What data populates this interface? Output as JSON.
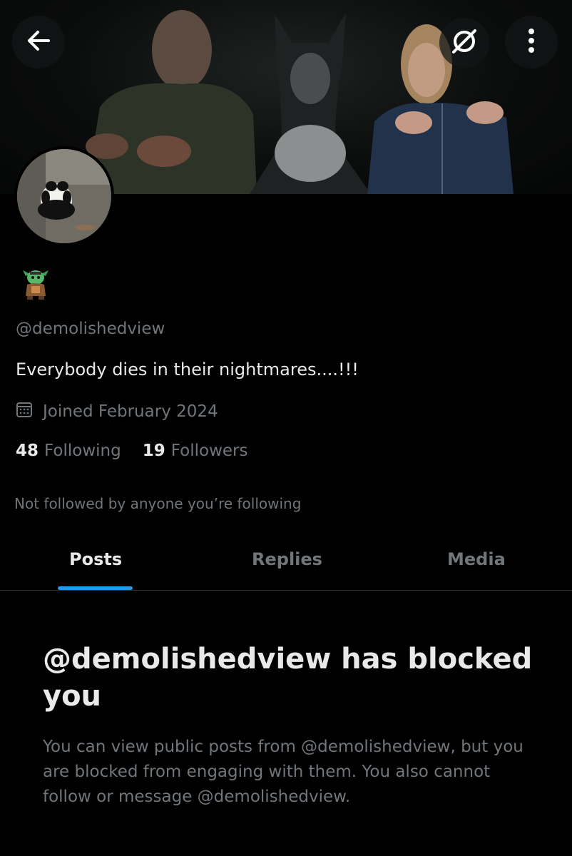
{
  "header": {
    "back_icon": "arrow-left-icon",
    "grok_icon": "grok-icon",
    "more_icon": "more-vertical-icon"
  },
  "profile": {
    "handle": "@demolishedview",
    "bio": "Everybody dies in their nightmares....!!!",
    "joined": "Joined February 2024",
    "following_count": "48",
    "following_label": "Following",
    "followers_count": "19",
    "followers_label": "Followers",
    "not_followed_note": "Not followed by anyone you’re following"
  },
  "tabs": [
    {
      "label": "Posts",
      "active": true
    },
    {
      "label": "Replies",
      "active": false
    },
    {
      "label": "Media",
      "active": false
    }
  ],
  "blocked": {
    "title": "@demolishedview has blocked you",
    "description": "You can view public posts from @demolishedview, but you are blocked from engaging with them. You also cannot follow or message @demolishedview."
  },
  "colors": {
    "background": "#000000",
    "text_primary": "#e7e9ea",
    "text_secondary": "#71767b",
    "accent": "#1d9bf0",
    "divider": "#2f3336"
  }
}
